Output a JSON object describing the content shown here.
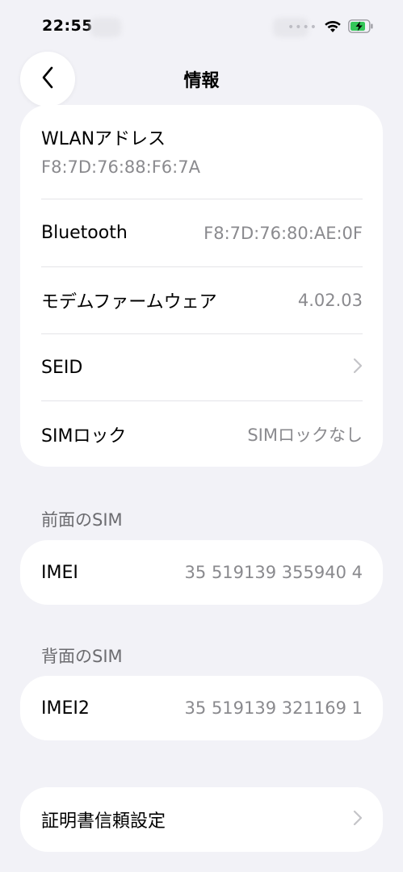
{
  "status_bar": {
    "time": "22:55",
    "icons": [
      "signal-dots",
      "wifi-icon",
      "battery-charging-icon"
    ]
  },
  "nav": {
    "back_icon": "chevron-left-icon",
    "title": "情報"
  },
  "card_main": {
    "wlan": {
      "label": "WLANアドレス",
      "value": "F8:7D:76:88:F6:7A"
    },
    "bluetooth": {
      "label": "Bluetooth",
      "value": "F8:7D:76:80:AE:0F"
    },
    "modem": {
      "label": "モデムファームウェア",
      "value": "4.02.03"
    },
    "seid": {
      "label": "SEID",
      "icon": "chevron-right-icon"
    },
    "sim_lock": {
      "label": "SIMロック",
      "value": "SIMロックなし"
    }
  },
  "front_sim": {
    "header": "前面のSIM",
    "imei": {
      "label": "IMEI",
      "value": "35 519139 355940 4"
    }
  },
  "back_sim": {
    "header": "背面のSIM",
    "imei2": {
      "label": "IMEI2",
      "value": "35 519139 321169 1"
    }
  },
  "certificate": {
    "label": "証明書信頼設定",
    "icon": "chevron-right-icon"
  },
  "colors": {
    "background": "#f2f2f7",
    "card": "#ffffff",
    "secondary_text": "#8a8a8e",
    "section_header": "#6c6c70",
    "battery_green": "#34c759"
  }
}
